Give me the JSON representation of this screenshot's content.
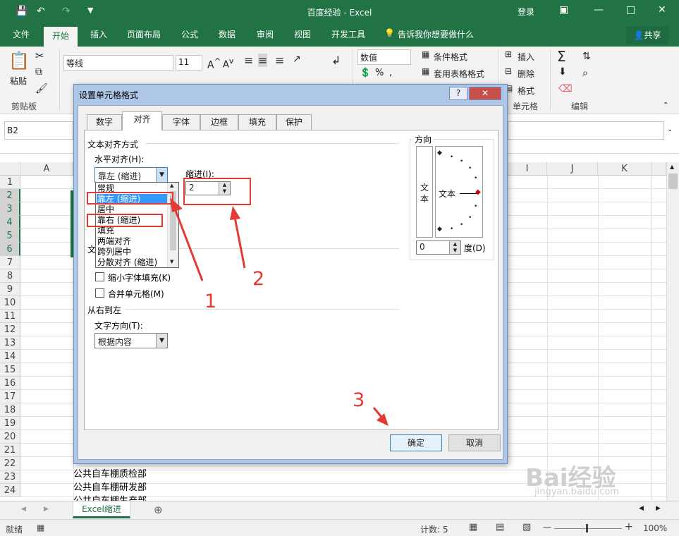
{
  "app": {
    "title": "百度经验  -  Excel",
    "login": "登录",
    "share": "共享"
  },
  "tabs": [
    "文件",
    "开始",
    "插入",
    "页面布局",
    "公式",
    "数据",
    "审阅",
    "视图",
    "开发工具"
  ],
  "tell_me": "告诉我你想要做什么",
  "ribbon": {
    "paste": "粘贴",
    "font_name": "等线",
    "font_size": "11",
    "number_format": "数值",
    "conditional_format": "条件格式",
    "table_format": "套用表格格式",
    "insert": "插入",
    "delete": "删除",
    "format": "格式",
    "group_clipboard": "剪贴板",
    "group_cells": "单元格",
    "group_edit": "编辑"
  },
  "name_box": "B2",
  "columns": [
    "A",
    "I",
    "J",
    "K"
  ],
  "rows": [
    "1",
    "2",
    "3",
    "4",
    "5",
    "6",
    "7",
    "8",
    "9",
    "10",
    "11",
    "12",
    "13",
    "14",
    "15",
    "16",
    "17",
    "18",
    "19",
    "20",
    "21",
    "22",
    "23",
    "24"
  ],
  "cells": {
    "r22": "公共自车棚质检部",
    "r23": "公共自车棚研发部",
    "r24": "公共自车棚生产部"
  },
  "sheet_tab": "Excel缩进",
  "status": {
    "ready": "就绪",
    "count": "计数: 5",
    "zoom": "100%"
  },
  "dialog": {
    "title": "设置单元格格式",
    "tabs": [
      "数字",
      "对齐",
      "字体",
      "边框",
      "填充",
      "保护"
    ],
    "section_align": "文本对齐方式",
    "h_align_label": "水平对齐(H):",
    "h_align_value": "靠左 (缩进)",
    "indent_label": "缩进(I):",
    "indent_value": "2",
    "options": [
      "常规",
      "靠左 (缩进)",
      "居中",
      "靠右 (缩进)",
      "填充",
      "两端对齐",
      "跨列居中",
      "分散对齐 (缩进)"
    ],
    "section_text": "文",
    "shrink_label": "缩小字体填充(K)",
    "merge_label": "合并单元格(M)",
    "section_rtl": "从右到左",
    "text_dir_label": "文字方向(T):",
    "text_dir_value": "根据内容",
    "orientation_label": "方向",
    "orientation_vertical": "文本",
    "orientation_text": "文本",
    "degree_value": "0",
    "degree_label": "度(D)",
    "ok": "确定",
    "cancel": "取消"
  },
  "annotations": [
    "1",
    "2",
    "3"
  ],
  "watermark": {
    "brand": "Bai经验",
    "url": "jingyan.baidu.com"
  },
  "colors": {
    "excel_green": "#217346",
    "annotation_red": "#e53935",
    "selected_option": "#3399ff"
  }
}
